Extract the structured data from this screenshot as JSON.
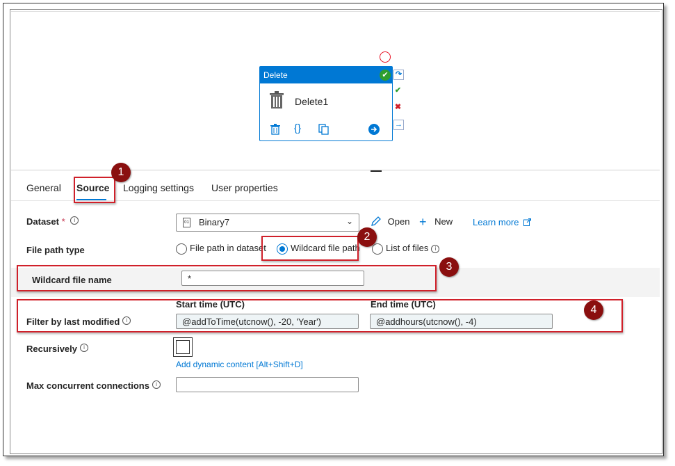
{
  "activity": {
    "header": "Delete",
    "name": "Delete1"
  },
  "tabs": [
    {
      "label": "General"
    },
    {
      "label": "Source"
    },
    {
      "label": "Logging settings"
    },
    {
      "label": "User properties"
    }
  ],
  "dataset": {
    "label": "Dataset",
    "required_marker": "*",
    "value": "Binary7",
    "open_label": "Open",
    "new_label": "New",
    "learn_more": "Learn more"
  },
  "file_path_type": {
    "label": "File path type",
    "options": [
      {
        "label": "File path in dataset",
        "selected": false
      },
      {
        "label": "Wildcard file path",
        "selected": true
      },
      {
        "label": "List of files",
        "selected": false
      }
    ]
  },
  "wildcard": {
    "label": "Wildcard file name",
    "value": "*"
  },
  "filter": {
    "label": "Filter by last modified",
    "start_label": "Start time (UTC)",
    "start_value": "@addToTime(utcnow(), -20, 'Year')",
    "end_label": "End time (UTC)",
    "end_value": "@addhours(utcnow(), -4)"
  },
  "recursively": {
    "label": "Recursively",
    "checked": false,
    "dynamic_link": "Add dynamic content [Alt+Shift+D]"
  },
  "max_connections": {
    "label": "Max concurrent connections",
    "value": ""
  },
  "callouts": [
    "1",
    "2",
    "3",
    "4"
  ],
  "colors": {
    "accent": "#0078d4",
    "callout_border": "#d0202a",
    "badge": "#8a0f0f"
  }
}
